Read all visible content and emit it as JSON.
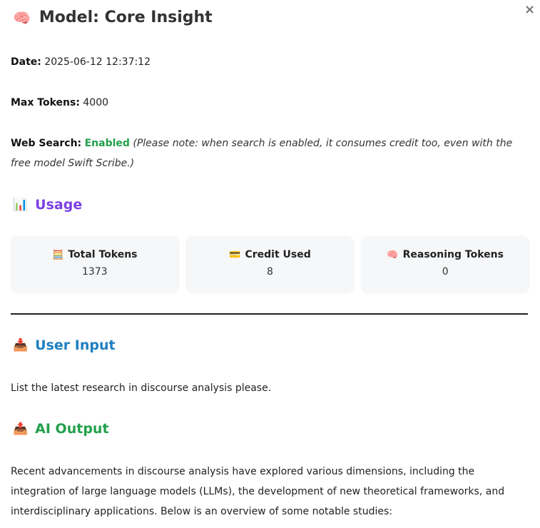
{
  "header": {
    "title_emoji": "🧠",
    "title": "Model: Core Insight",
    "close_label": "×"
  },
  "meta": {
    "date_label": "Date:",
    "date_value": "2025-06-12 12:37:12",
    "max_tokens_label": "Max Tokens:",
    "max_tokens_value": "4000",
    "web_search_label": "Web Search:",
    "web_search_value": "Enabled",
    "web_search_note": "(Please note: when search is enabled, it consumes credit too, even with the free model Swift Scribe.)"
  },
  "usage": {
    "heading_emoji": "📊",
    "heading": "Usage",
    "cards": [
      {
        "emoji": "🧮",
        "label": "Total Tokens",
        "value": "1373"
      },
      {
        "emoji": "💳",
        "label": "Credit Used",
        "value": "8"
      },
      {
        "emoji": "🧠",
        "label": "Reasoning Tokens",
        "value": "0"
      }
    ]
  },
  "user_input": {
    "heading_emoji": "📥",
    "heading": "User Input",
    "text": "List the latest research in discourse analysis please."
  },
  "ai_output": {
    "heading_emoji": "📤",
    "heading": "AI Output",
    "text": "Recent advancements in discourse analysis have explored various dimensions, including the integration of large language models (LLMs), the development of new theoretical frameworks, and interdisciplinary applications. Below is an overview of some notable studies:"
  },
  "colors": {
    "usage_heading": "#7b3fe4",
    "user_input_heading": "#1e7fc0",
    "ai_output_heading": "#22a04b",
    "enabled": "#22a04b"
  }
}
